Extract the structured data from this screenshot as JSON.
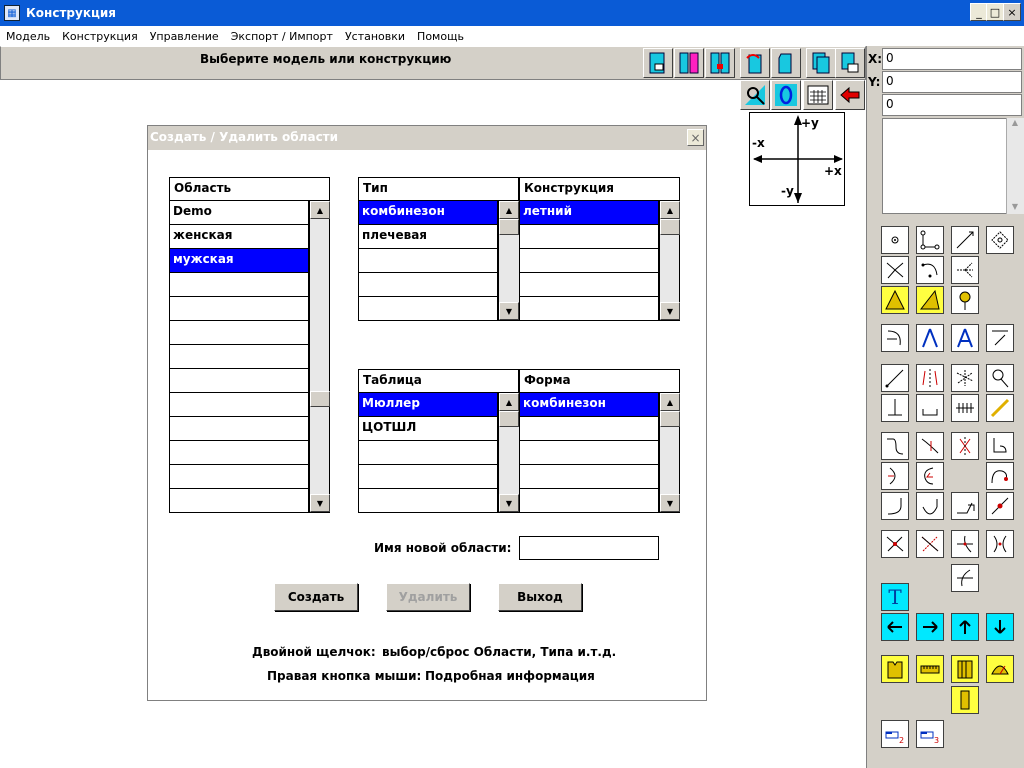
{
  "window": {
    "title": "Конструкция",
    "minimize": "_",
    "maximize": "□",
    "close": "×"
  },
  "menu": [
    "Модель",
    "Конструкция",
    "Управление",
    "Экспорт / Импорт",
    "Установки",
    "Помощь"
  ],
  "status": {
    "message": "Выберите модель или конструкцию"
  },
  "coords": {
    "x_label": "X:",
    "y_label": "Y:",
    "x_value": "0",
    "y_value": "0",
    "z_value": "0"
  },
  "axes": {
    "plus_y": "+y",
    "minus_y": "-y",
    "plus_x": "+x",
    "minus_x": "-x"
  },
  "dialog": {
    "title": "Создать / Удалить области",
    "close": "×",
    "oblast": {
      "header": "Область",
      "items": [
        "Demo",
        "женская",
        "мужская",
        "",
        "",
        "",
        "",
        "",
        "",
        "",
        "",
        "",
        ""
      ],
      "selected": 2
    },
    "tip": {
      "header": "Тип",
      "items": [
        "комбинезон",
        "плечевая",
        "",
        "",
        ""
      ],
      "selected": 0
    },
    "konstr": {
      "header": "Конструкция",
      "items": [
        "летний",
        "",
        "",
        "",
        ""
      ],
      "selected": 0
    },
    "tablica": {
      "header": "Таблица",
      "items": [
        "Мюллер",
        "ЦОТШЛ",
        "",
        "",
        ""
      ],
      "selected": 0
    },
    "forma": {
      "header": "Форма",
      "items": [
        "комбинезон",
        "",
        "",
        "",
        ""
      ],
      "selected": 0
    },
    "new_name_label": "Имя новой области:",
    "new_name_value": "",
    "buttons": {
      "create": "Создать",
      "delete": "Удалить",
      "exit": "Выход"
    },
    "hint1_label": "Двойной щелчок:",
    "hint1_text": "выбор/сброс Области, Типа и.т.д.",
    "hint2_label": "Правая кнопка мыши:",
    "hint2_text": "Подробная информация"
  },
  "tools": {
    "text_tool": "T"
  },
  "colors": {
    "titlebar": "#0a5bd6",
    "selection": "#0000ff",
    "tool_cyan": "#00e8ff",
    "tool_yellow": "#ffff40"
  }
}
